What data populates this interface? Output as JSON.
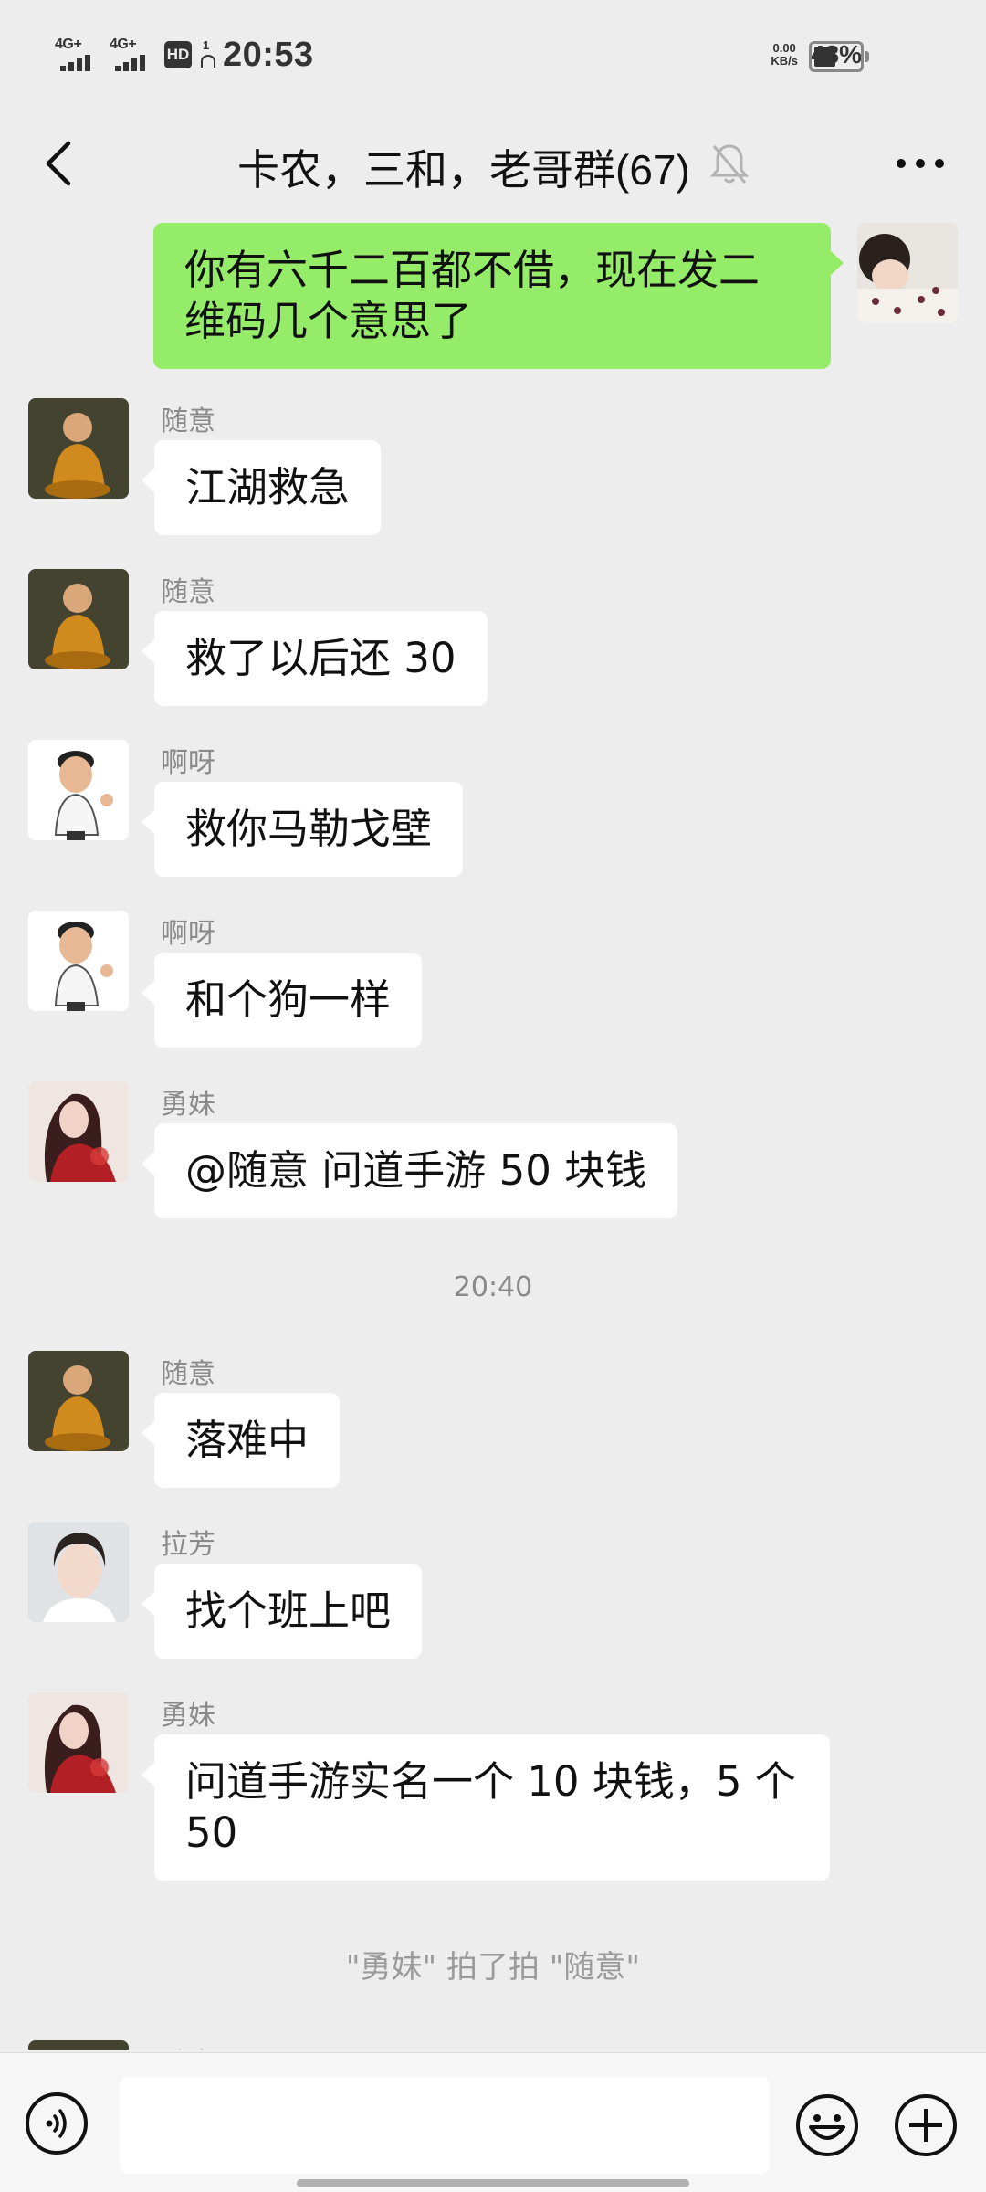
{
  "status_bar": {
    "network_1": "4G+",
    "network_2": "4G+",
    "hd": "HD",
    "hd_sub": "1",
    "time": "20:53",
    "speed_value": "0.00",
    "speed_unit": "KB/s",
    "battery_percent": "48%",
    "battery_level": 0.48
  },
  "header": {
    "title": "卡农，三和，老哥群(67)",
    "back_icon": "chevron-left-icon",
    "mute_icon": "bell-off-icon",
    "more_icon": "ellipsis-icon"
  },
  "messages": [
    {
      "side": "right",
      "text": "你有六千二百都不借，现在发二维码几个意思了",
      "avatar": "self"
    },
    {
      "side": "left",
      "sender": "随意",
      "text": "江湖救急",
      "avatar": "monk"
    },
    {
      "side": "left",
      "sender": "随意",
      "text": "救了以后还 30",
      "avatar": "monk"
    },
    {
      "side": "left",
      "sender": "啊呀",
      "text": "救你马勒戈壁",
      "avatar": "cartoon-man"
    },
    {
      "side": "left",
      "sender": "啊呀",
      "text": "和个狗一样",
      "avatar": "cartoon-man"
    },
    {
      "side": "left",
      "sender": "勇妹",
      "text": "@随意  问道手游 50 块钱",
      "avatar": "red-lady"
    },
    {
      "type": "time",
      "text": "20:40"
    },
    {
      "side": "left",
      "sender": "随意",
      "text": "落难中",
      "avatar": "monk"
    },
    {
      "side": "left",
      "sender": "拉芳",
      "text": "找个班上吧",
      "avatar": "young-man"
    },
    {
      "side": "left",
      "sender": "勇妹",
      "text": "问道手游实名一个 10 块钱，5 个 50",
      "avatar": "red-lady"
    },
    {
      "type": "system",
      "text": "\"勇妹\" 拍了拍 \"随意\""
    },
    {
      "side": "left",
      "sender": "随意",
      "avatar": "monk"
    }
  ],
  "input_bar": {
    "voice_icon": "voice-icon",
    "input_value": "",
    "emoji_icon": "emoji-icon",
    "plus_icon": "plus-icon"
  },
  "colors": {
    "background": "#ededed",
    "my_bubble": "#95ec69",
    "other_bubble": "#ffffff",
    "meta_text": "#8a8a8a"
  }
}
